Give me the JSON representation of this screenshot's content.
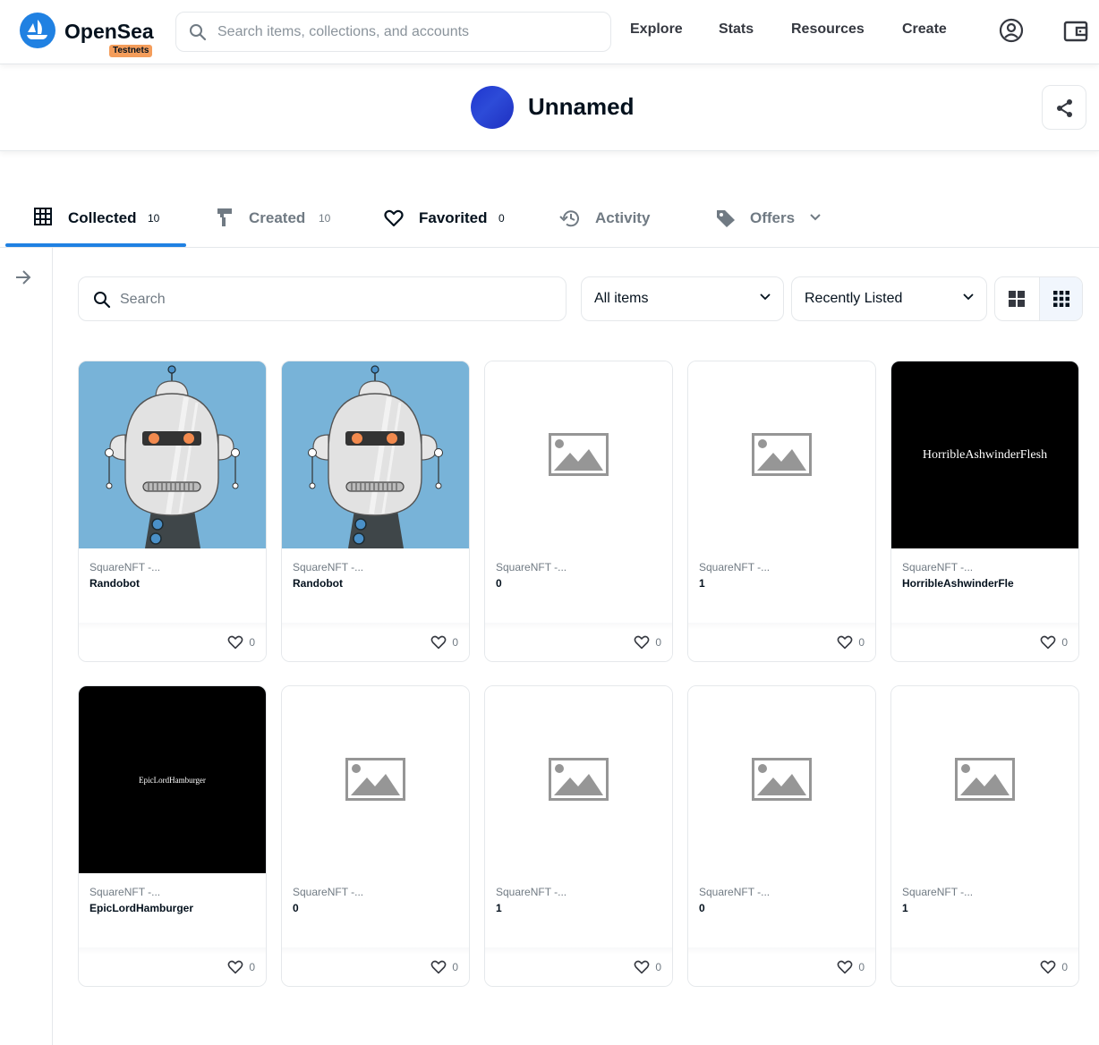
{
  "nav": {
    "brand": "OpenSea",
    "badge": "Testnets",
    "search_placeholder": "Search items, collections, and accounts",
    "links": [
      "Explore",
      "Stats",
      "Resources",
      "Create"
    ],
    "brand_color": "#2081e2"
  },
  "profile": {
    "name": "Unnamed"
  },
  "tabs": [
    {
      "label": "Collected",
      "count": "10",
      "icon": "grid-icon",
      "active": true
    },
    {
      "label": "Created",
      "count": "10",
      "icon": "paintbrush-icon"
    },
    {
      "label": "Favorited",
      "count": "0",
      "icon": "heart-icon"
    },
    {
      "label": "Activity",
      "icon": "history-icon"
    },
    {
      "label": "Offers",
      "icon": "tag-icon"
    }
  ],
  "filters": {
    "search_placeholder": "Search",
    "items_select": "All items",
    "sort_select": "Recently Listed"
  },
  "items": [
    {
      "collection": "SquareNFT -...",
      "title": "Randobot",
      "likes": "0",
      "media": "robot"
    },
    {
      "collection": "SquareNFT -...",
      "title": "Randobot",
      "likes": "0",
      "media": "robot"
    },
    {
      "collection": "SquareNFT -...",
      "title": "0",
      "likes": "0",
      "media": "placeholder"
    },
    {
      "collection": "SquareNFT -...",
      "title": "1",
      "likes": "0",
      "media": "placeholder"
    },
    {
      "collection": "SquareNFT -...",
      "title": "HorribleAshwinderFlesh",
      "likes": "0",
      "media": "text",
      "media_text": "HorribleAshwinderFlesh"
    },
    {
      "collection": "SquareNFT -...",
      "title": "EpicLordHamburger",
      "likes": "0",
      "media": "text",
      "media_text": "EpicLordHamburger"
    },
    {
      "collection": "SquareNFT -...",
      "title": "0",
      "likes": "0",
      "media": "placeholder"
    },
    {
      "collection": "SquareNFT -...",
      "title": "1",
      "likes": "0",
      "media": "placeholder"
    },
    {
      "collection": "SquareNFT -...",
      "title": "0",
      "likes": "0",
      "media": "placeholder"
    },
    {
      "collection": "SquareNFT -...",
      "title": "1",
      "likes": "0",
      "media": "placeholder"
    }
  ]
}
